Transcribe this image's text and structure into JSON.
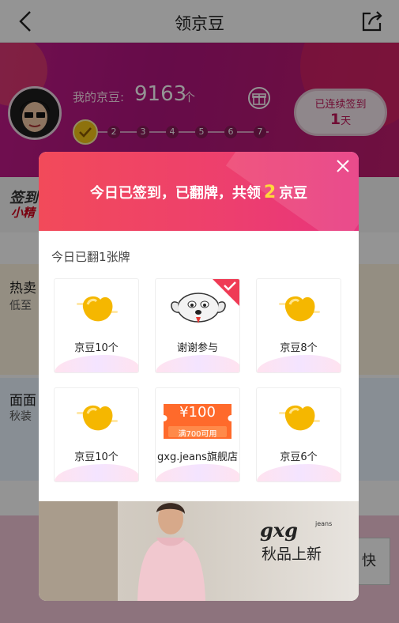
{
  "nav": {
    "title": "领京豆",
    "back_icon": "chevron-left-icon",
    "share_icon": "share-icon"
  },
  "header": {
    "beans_label": "我的京豆:",
    "beans_count": "9163",
    "beans_unit": "个",
    "streak_line1": "已连续签到",
    "streak_days": "1",
    "streak_unit": "天",
    "days": [
      "2",
      "3",
      "4",
      "5",
      "6",
      "7"
    ]
  },
  "underlying": {
    "sign_text": "签到",
    "small_text": "小精",
    "hot_title": "热卖",
    "hot_sub": "低至",
    "face_title": "面面",
    "face_sub": "秋装",
    "side_button": "快"
  },
  "modal": {
    "message_prefix": "今日已签到，已翻牌，共领",
    "message_number": "2",
    "message_suffix": "京豆",
    "flipped_text": "今日已翻1张牌",
    "cards": [
      {
        "label": "京豆10个",
        "kind": "bean"
      },
      {
        "label": "谢谢参与",
        "kind": "thanks",
        "checked": true
      },
      {
        "label": "京豆8个",
        "kind": "bean"
      },
      {
        "label": "京豆10个",
        "kind": "bean"
      },
      {
        "label": "gxg.jeans旗舰店",
        "kind": "coupon",
        "coupon_amount": "¥100",
        "coupon_condition": "满700可用"
      },
      {
        "label": "京豆6个",
        "kind": "bean"
      }
    ],
    "ad": {
      "brand": "gxg",
      "brand_sub": "jeans",
      "tagline": "秋品上新"
    }
  },
  "colors": {
    "accent": "#ed3f6e",
    "brand_magenta": "#b0157e",
    "gold": "#f5c518"
  }
}
